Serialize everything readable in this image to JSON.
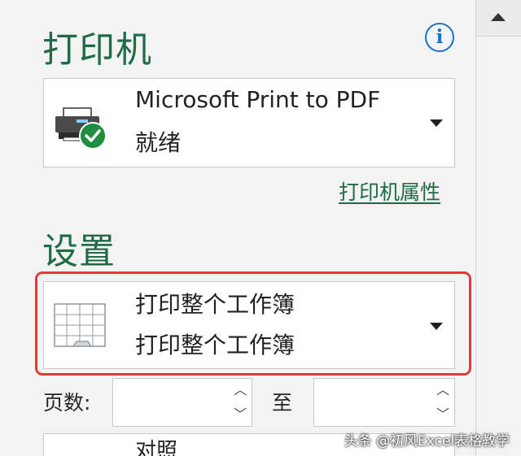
{
  "printer_section": {
    "title": "打印机",
    "info_icon": "info-icon",
    "printer": {
      "name": "Microsoft Print to PDF",
      "status": "就绪",
      "icon": "printer-ready-icon"
    },
    "properties_link": "打印机属性"
  },
  "settings_section": {
    "title": "设置",
    "print_what": {
      "line1": "打印整个工作簿",
      "line2": "打印整个工作簿",
      "icon": "workbook-grid-icon"
    },
    "pages": {
      "label": "页数:",
      "from_value": "",
      "to_label": "至",
      "to_value": ""
    },
    "next_option_partial": "对照"
  },
  "watermark": "头条 @初风Excel表格教学",
  "colors": {
    "accent_green": "#1e6b45",
    "info_blue": "#1a73c9",
    "highlight_red": "#e53935",
    "check_green": "#1e8e3e"
  }
}
